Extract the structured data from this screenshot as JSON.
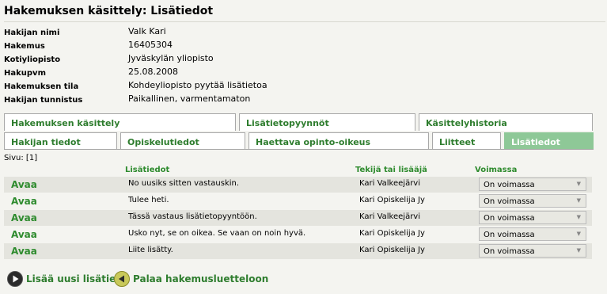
{
  "title": "Hakemuksen käsittely: Lisätiedot",
  "info": [
    {
      "label": "Hakijan nimi",
      "value": "Valk Kari"
    },
    {
      "label": "Hakemus",
      "value": "16405304"
    },
    {
      "label": "Kotiyliopisto",
      "value": "Jyväskylän yliopisto"
    },
    {
      "label": "Hakupvm",
      "value": "25.08.2008"
    },
    {
      "label": "Hakemuksen tila",
      "value": "Kohdeyliopisto pyytää lisätietoa"
    },
    {
      "label": "Hakijan tunnistus",
      "value": "Paikallinen, varmentamaton"
    }
  ],
  "tabs_top": [
    "Hakemuksen käsittely",
    "Lisätietopyynnöt",
    "Käsittelyhistoria"
  ],
  "tabs_bottom": [
    "Hakijan tiedot",
    "Opiskelutiedot",
    "Haettava opinto-oikeus",
    "Liitteet",
    "Lisätiedot"
  ],
  "page_label": "Sivu: [1]",
  "table": {
    "headers": {
      "info": "Lisätiedot",
      "author": "Tekijä tai lisääjä",
      "status": "Voimassa"
    },
    "open_label": "Avaa",
    "rows": [
      {
        "text": "No uusiks sitten vastauskin.",
        "author": "Kari Valkeejärvi",
        "status": "On voimassa"
      },
      {
        "text": "Tulee heti.",
        "author": "Kari Opiskelija Jy",
        "status": "On voimassa"
      },
      {
        "text": "Tässä vastaus lisätietopyyntöön.",
        "author": "Kari Valkeejärvi",
        "status": "On voimassa"
      },
      {
        "text": "Usko nyt, se on oikea. Se vaan on noin hyvä.",
        "author": "Kari Opiskelija Jy",
        "status": "On voimassa"
      },
      {
        "text": "Liite lisätty.",
        "author": "Kari Opiskelija Jy",
        "status": "On voimassa"
      }
    ]
  },
  "actions": {
    "add": "Lisää uusi lisätieto",
    "back": "Palaa hakemusluetteloon"
  }
}
